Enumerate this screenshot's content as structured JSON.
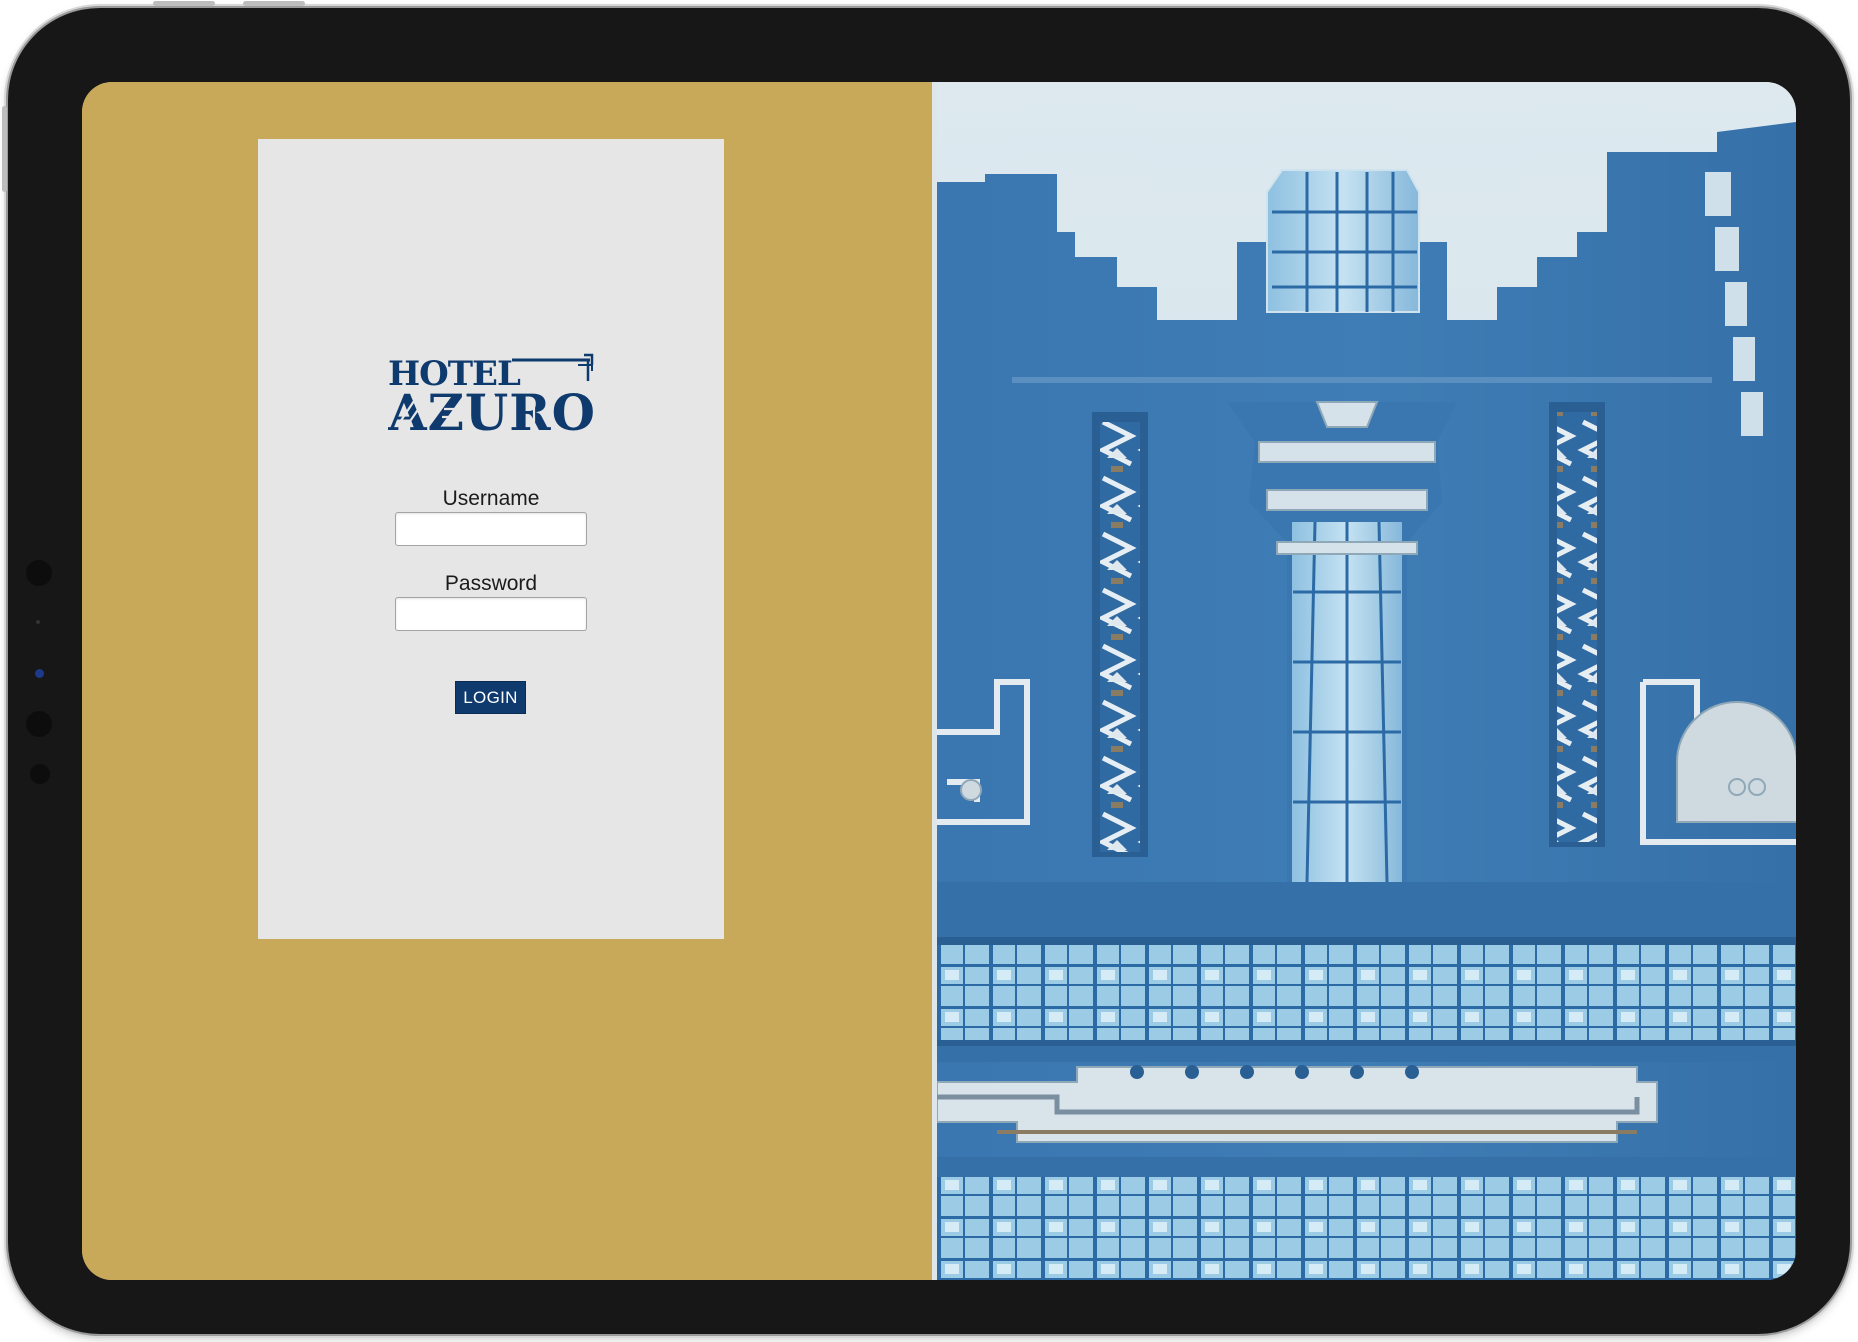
{
  "brand": {
    "name_line1": "HOTEL",
    "name_line2": "AZURO",
    "color": "#0f3a6e"
  },
  "login": {
    "username_label": "Username",
    "username_value": "",
    "password_label": "Password",
    "password_value": "",
    "button_label": "LOGIN"
  },
  "colors": {
    "background_gold": "#c8a95a",
    "card_gray": "#e6e6e6",
    "button_navy": "#0f3a6e",
    "building_blue": "#3a78b2"
  },
  "hero_image": {
    "subject": "art-deco-building-facade"
  }
}
